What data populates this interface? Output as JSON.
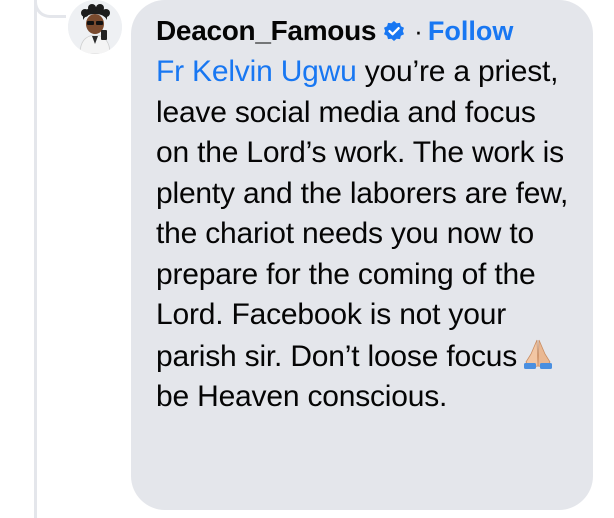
{
  "comment": {
    "author": "Deacon_Famous",
    "separator": "·",
    "follow_label": "Follow",
    "mention": "Fr Kelvin Ugwu",
    "text_part1": " you’re a priest, leave social media and focus on the Lord’s work. The work is plenty and the laborers are few, the chariot needs you now to prepare for the coming of the Lord. Facebook is not your parish sir. Don’t loose focus",
    "text_part2": " be Heaven conscious.",
    "icons": {
      "badge": "verified-badge-icon",
      "emoji": "folded-hands-emoji-icon"
    }
  },
  "colors": {
    "bubble": "#e4e6eb",
    "link": "#1877f2",
    "text": "#050505",
    "thread_line": "#e4e6eb"
  }
}
